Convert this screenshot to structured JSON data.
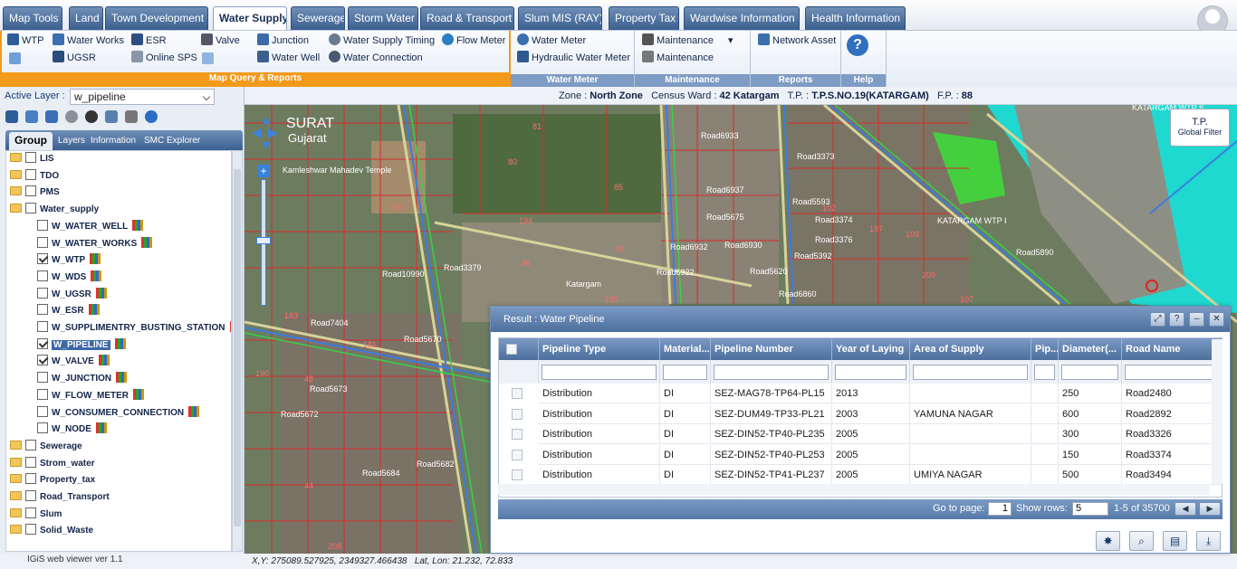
{
  "tabs": [
    "Map Tools",
    "Land",
    "Town Development",
    "Water Supply",
    "Sewerage",
    "Storm Water",
    "Road & Transport",
    "Slum MIS (RAY)",
    "Property Tax",
    "Wardwise Information",
    "Health Information"
  ],
  "active_tab": "Water Supply",
  "ribbon": {
    "map_query": {
      "label": "Map Query & Reports",
      "items": [
        "WTP",
        "Water Works",
        "ESR",
        "Valve",
        "Junction",
        "Water Supply Timing",
        "Flow Meter",
        "UGSR",
        "Online SPS",
        "Water Well",
        "Water Connection"
      ]
    },
    "water_meter": {
      "label": "Water Meter",
      "items": [
        "Water Meter",
        "Hydraulic Water Meter"
      ]
    },
    "maintenance": {
      "label": "Maintenance",
      "items": [
        "Maintenance",
        "Maintenance"
      ]
    },
    "reports": {
      "label": "Reports",
      "items": [
        "Network Asset"
      ]
    },
    "help": {
      "label": "Help"
    }
  },
  "info": {
    "zone_label": "Zone :",
    "zone": "North Zone",
    "ward_label": "Census Ward :",
    "ward": "42 Katargam",
    "tp_label": "T.P. :",
    "tp": "T.P.S.NO.19(KATARGAM)",
    "fp_label": "F.P. :",
    "fp": "88"
  },
  "left": {
    "active_layer_label": "Active Layer :",
    "active_layer": "w_pipeline",
    "tabs": [
      "Group",
      "Layers",
      "Information",
      "SMC Explorer"
    ],
    "tree": [
      {
        "label": "LIS",
        "type": "group",
        "checked": false
      },
      {
        "label": "TDO",
        "type": "group",
        "checked": false
      },
      {
        "label": "PMS",
        "type": "group",
        "checked": false
      },
      {
        "label": "Water_supply",
        "type": "group",
        "checked": false
      },
      {
        "label": "W_WATER_WELL",
        "type": "layer",
        "checked": false
      },
      {
        "label": "W_WATER_WORKS",
        "type": "layer",
        "checked": false
      },
      {
        "label": "W_WTP",
        "type": "layer",
        "checked": true
      },
      {
        "label": "W_WDS",
        "type": "layer",
        "checked": false
      },
      {
        "label": "W_UGSR",
        "type": "layer",
        "checked": false
      },
      {
        "label": "W_ESR",
        "type": "layer",
        "checked": false
      },
      {
        "label": "W_SUPPLIMENTRY_BUSTING_STATION",
        "type": "layer",
        "checked": false
      },
      {
        "label": "W_PIPELINE",
        "type": "layer",
        "checked": true,
        "selected": true
      },
      {
        "label": "W_VALVE",
        "type": "layer",
        "checked": true
      },
      {
        "label": "W_JUNCTION",
        "type": "layer",
        "checked": false
      },
      {
        "label": "W_FLOW_METER",
        "type": "layer",
        "checked": false
      },
      {
        "label": "W_CONSUMER_CONNECTION",
        "type": "layer",
        "checked": false
      },
      {
        "label": "W_NODE",
        "type": "layer",
        "checked": false
      },
      {
        "label": "Sewerage",
        "type": "group",
        "checked": false
      },
      {
        "label": "Strom_water",
        "type": "group",
        "checked": false
      },
      {
        "label": "Property_tax",
        "type": "group",
        "checked": false
      },
      {
        "label": "Road_Transport",
        "type": "group",
        "checked": false
      },
      {
        "label": "Slum",
        "type": "group",
        "checked": false
      },
      {
        "label": "Solid_Waste",
        "type": "group",
        "checked": false
      }
    ],
    "version": "IGiS web viewer ver 1.1"
  },
  "status": {
    "xy_label": "X,Y:",
    "xy": "275089.527925, 2349327.466438",
    "ll_label": "Lat, Lon:",
    "ll": "21.232, 72.833"
  },
  "map": {
    "tp_filter_title": "T.P.",
    "tp_filter_sub": "Global Filter",
    "labels": [
      "SURAT",
      "Gujarat",
      "Kamleshwar Mahadev Temple",
      "KATARGAM WTP II",
      "KATARGAM WTP I",
      "Katargam",
      "Road10990",
      "Road3379",
      "Road7404",
      "Road5670",
      "Road5673",
      "Road5672",
      "Road5684",
      "Road5682",
      "Road6933",
      "Road6937",
      "Road5675",
      "Road6922",
      "Road5620",
      "Road5890",
      "Road3374",
      "Road3376",
      "Road3373",
      "Road5593",
      "Road5392",
      "Road6860",
      "Road6930",
      "Road6932"
    ],
    "numbers": [
      "81",
      "80",
      "85",
      "50",
      "194",
      "86",
      "87",
      "195",
      "197",
      "109",
      "102",
      "209",
      "107",
      "181",
      "183",
      "190",
      "48",
      "44",
      "208"
    ]
  },
  "result": {
    "title": "Result : Water Pipeline",
    "columns": [
      "Pipeline Type",
      "Material...",
      "Pipeline Number",
      "Year of Laying",
      "Area of Supply",
      "Pip...",
      "Diameter(...",
      "Road Name"
    ],
    "rows": [
      [
        "Distribution",
        "DI",
        "SEZ-MAG78-TP64-PL15",
        "2013",
        "",
        "",
        "250",
        "Road2480"
      ],
      [
        "Distribution",
        "DI",
        "SEZ-DUM49-TP33-PL21",
        "2003",
        "YAMUNA NAGAR",
        "",
        "600",
        "Road2892"
      ],
      [
        "Distribution",
        "DI",
        "SEZ-DIN52-TP40-PL235",
        "2005",
        "",
        "",
        "300",
        "Road3326"
      ],
      [
        "Distribution",
        "DI",
        "SEZ-DIN52-TP40-PL253",
        "2005",
        "",
        "",
        "150",
        "Road3374"
      ],
      [
        "Distribution",
        "DI",
        "SEZ-DIN52-TP41-PL237",
        "2005",
        "UMIYA NAGAR",
        "",
        "500",
        "Road3494"
      ]
    ],
    "pager": {
      "goto_label": "Go to page:",
      "page": "1",
      "rows_label": "Show rows:",
      "rows": "5",
      "range": "1-5 of 35700"
    }
  },
  "colors": {
    "accent": "#f29a1a",
    "primary": "#4d6f9d"
  }
}
